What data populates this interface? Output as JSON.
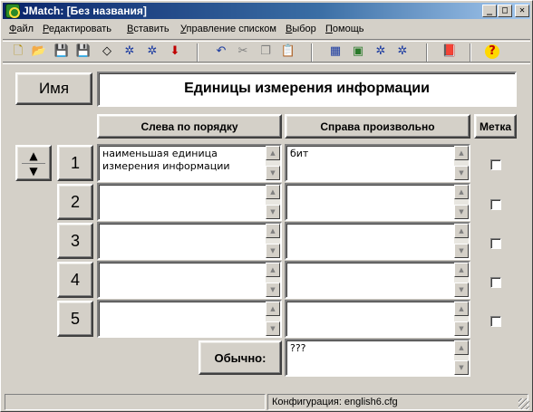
{
  "window": {
    "title": "JMatch: [Без названия]",
    "minimize": "_",
    "maximize": "□",
    "close": "✕"
  },
  "menu": [
    "Файл",
    "Редактировать",
    "Вставить",
    "Управление списком",
    "Выбор",
    "Помощь"
  ],
  "toolbar": {
    "icons": [
      "new-icon",
      "open-icon",
      "save-icon",
      "save-as-icon",
      "eraser-icon",
      "export-web-6-icon",
      "export-web-6b-icon",
      "down-arrow-icon",
      "undo-icon",
      "cut-icon",
      "copy-icon",
      "paste-icon",
      "web-export-icon",
      "picture-icon",
      "web-export-alt-icon",
      "web-tool-icon",
      "book-icon",
      "help-icon"
    ],
    "glyphs": [
      "🗋",
      "📂",
      "💾",
      "💾",
      "◇",
      "✲",
      "✲",
      "⬇",
      "↶",
      "✂",
      "❐",
      "📋",
      "▦",
      "▣",
      "✲",
      "✲",
      "📕",
      "?"
    ]
  },
  "name_button": "Имя",
  "title_value": "Единицы измерения информации",
  "headers": {
    "left": "Слева по порядку",
    "right": "Справа произвольно",
    "mark": "Метка"
  },
  "rows": [
    {
      "num": "1",
      "left": "наименьшая единица\nизмерения информации",
      "right": "бит",
      "checked": false
    },
    {
      "num": "2",
      "left": "",
      "right": "",
      "checked": false
    },
    {
      "num": "3",
      "left": "",
      "right": "",
      "checked": false
    },
    {
      "num": "4",
      "left": "",
      "right": "",
      "checked": false
    },
    {
      "num": "5",
      "left": "",
      "right": "",
      "checked": false
    }
  ],
  "default_label": "Обычно:",
  "default_value": "???",
  "status": {
    "config": "Конфигурация: english6.cfg"
  },
  "colors": {
    "face": "#d4d0c8",
    "titlebar_start": "#0a246a",
    "titlebar_end": "#a6caf0"
  }
}
